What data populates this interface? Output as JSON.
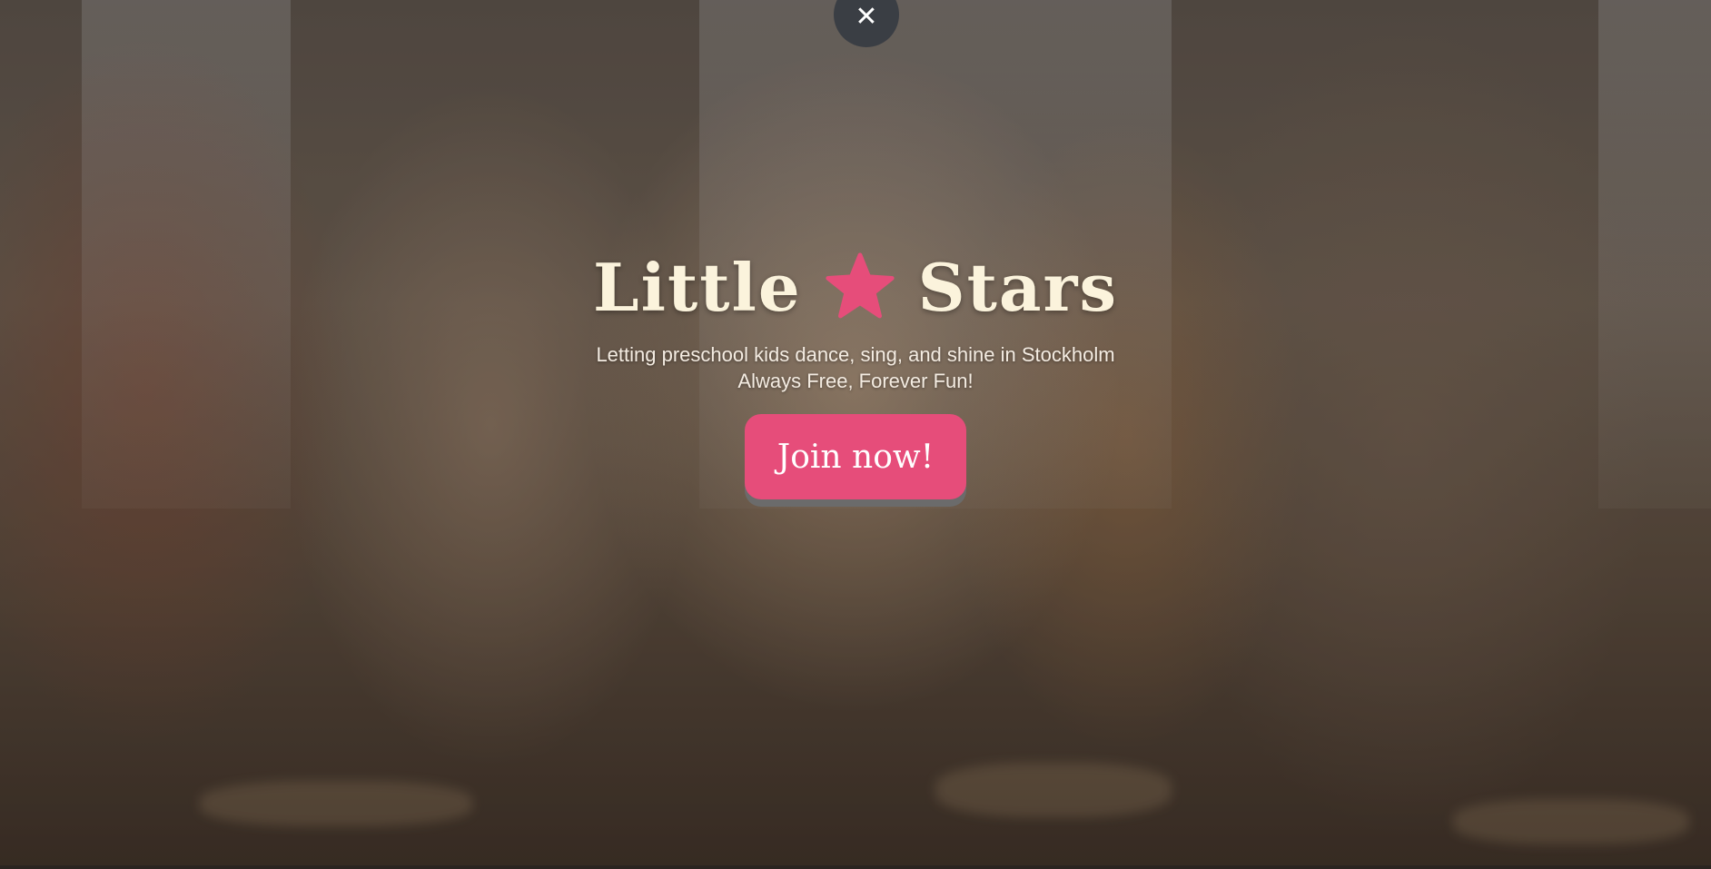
{
  "hero": {
    "title_word_1": "Little",
    "title_word_2": "Stars",
    "star_icon": "star-icon",
    "tagline_line_1": "Letting preschool kids dance, sing, and shine in Stockholm",
    "tagline_line_2": "Always Free, Forever Fun!",
    "cta_label": "Join now!",
    "close_icon": "close-icon",
    "close_glyph": "✕"
  },
  "colors": {
    "accent": "#e64d7a",
    "title_text": "#fbf3dc",
    "close_button_bg": "#3a3e44"
  }
}
